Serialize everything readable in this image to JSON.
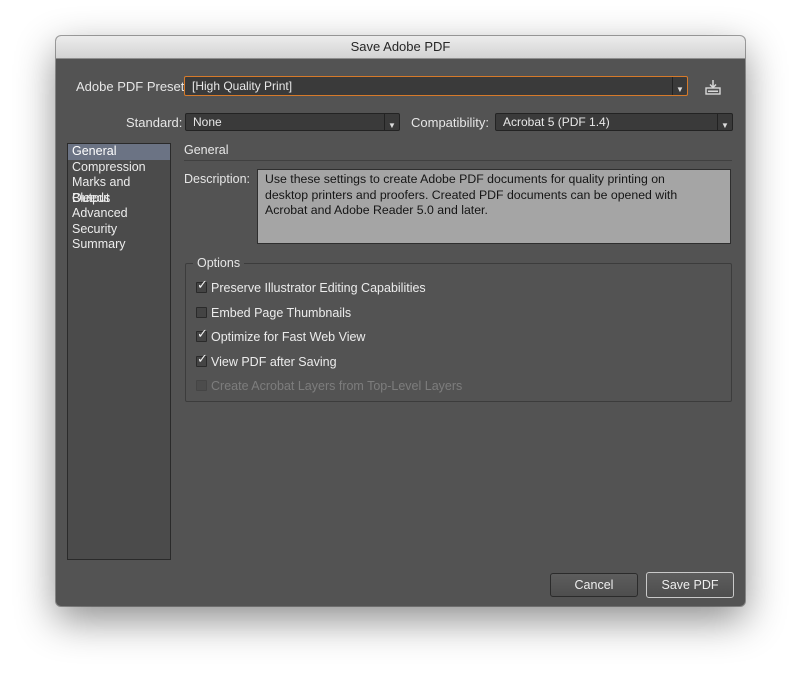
{
  "window": {
    "title": "Save Adobe PDF"
  },
  "preset": {
    "label": "Adobe PDF Preset:",
    "value": "[High Quality Print]",
    "save_icon": "save-preset-icon"
  },
  "standard": {
    "label": "Standard:",
    "value": "None"
  },
  "compatibility": {
    "label": "Compatibility:",
    "value": "Acrobat 5 (PDF 1.4)"
  },
  "sidebar": {
    "items": [
      {
        "label": "General",
        "selected": true
      },
      {
        "label": "Compression"
      },
      {
        "label": "Marks and Bleeds"
      },
      {
        "label": "Output"
      },
      {
        "label": "Advanced"
      },
      {
        "label": "Security"
      },
      {
        "label": "Summary"
      }
    ]
  },
  "general": {
    "title": "General",
    "description_label": "Description:",
    "description_lines": [
      "Use these settings to create Adobe PDF documents for quality printing on",
      "desktop printers and proofers.  Created PDF documents can be opened with",
      "Acrobat and Adobe Reader 5.0 and later."
    ]
  },
  "options": {
    "title": "Options",
    "items": [
      {
        "label": "Preserve Illustrator Editing Capabilities",
        "checked": true
      },
      {
        "label": "Embed Page Thumbnails",
        "checked": false
      },
      {
        "label": "Optimize for Fast Web View",
        "checked": true
      },
      {
        "label": "View PDF after Saving",
        "checked": true
      },
      {
        "label": "Create Acrobat Layers from Top-Level Layers",
        "checked": false,
        "disabled": true
      }
    ]
  },
  "buttons": {
    "cancel": "Cancel",
    "save": "Save PDF"
  },
  "colors": {
    "dialog_bg": "#535353",
    "focus_accent": "#d67a2a",
    "selection": "#6b7384"
  }
}
